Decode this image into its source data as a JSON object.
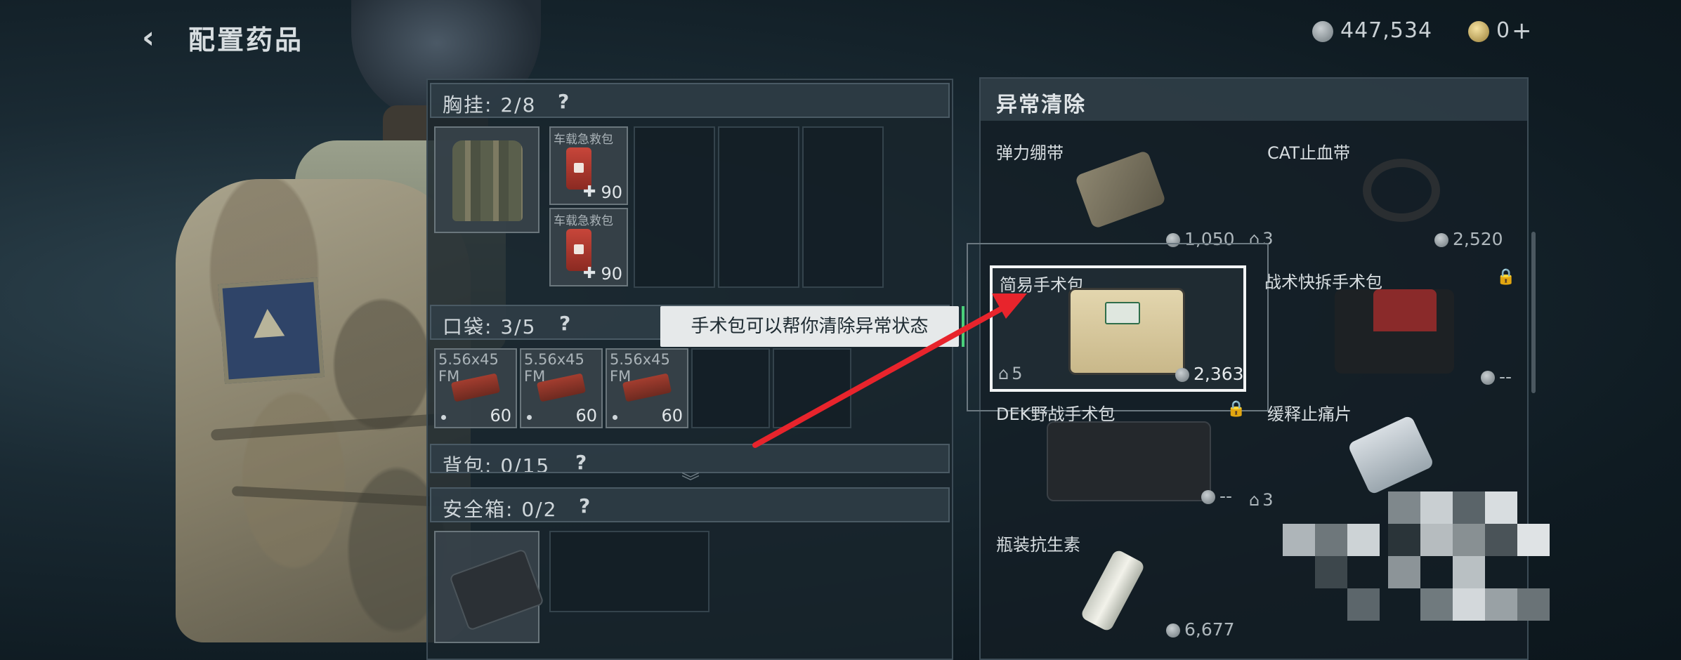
{
  "header": {
    "back_icon": "‹",
    "title": "配置药品"
  },
  "currency": {
    "silver": "447,534",
    "gold": "0",
    "plus": "+"
  },
  "left": {
    "sections": [
      {
        "label": "胸挂: 2/8",
        "q": "?"
      },
      {
        "label": "口袋: 3/5",
        "q": "?"
      },
      {
        "label": "背包: 0/15",
        "q": "?"
      },
      {
        "label": "安全箱: 0/2",
        "q": "?"
      }
    ],
    "chest_items": [
      {
        "name": "车载急救包",
        "value": "90",
        "plus": "✚"
      },
      {
        "name": "车载急救包",
        "value": "90",
        "plus": "✚"
      }
    ],
    "pocket_items": [
      {
        "name": "5.56x45",
        "sub": "FM",
        "value": "60"
      },
      {
        "name": "5.56x45",
        "sub": "FM",
        "value": "60"
      },
      {
        "name": "5.56x45",
        "sub": "FM",
        "value": "60"
      }
    ],
    "expand_icon": "︾"
  },
  "tooltip": "手术包可以帮你清除异常状态",
  "right": {
    "title": "异常清除",
    "items": [
      {
        "name": "弹力绷带",
        "price": "1,050"
      },
      {
        "name": "CAT止血带",
        "stock": "3",
        "price": "2,520"
      },
      {
        "name": "简易手术包",
        "stock": "5",
        "price": "2,363"
      },
      {
        "name": "战术快拆手术包",
        "price": "--",
        "locked": true
      },
      {
        "name": "DEK野战手术包",
        "price": "--",
        "locked": true
      },
      {
        "name": "缓释止痛片",
        "stock": "3"
      },
      {
        "name": "瓶装抗生素",
        "price": "6,677"
      }
    ],
    "lock_icon": "🔒"
  }
}
